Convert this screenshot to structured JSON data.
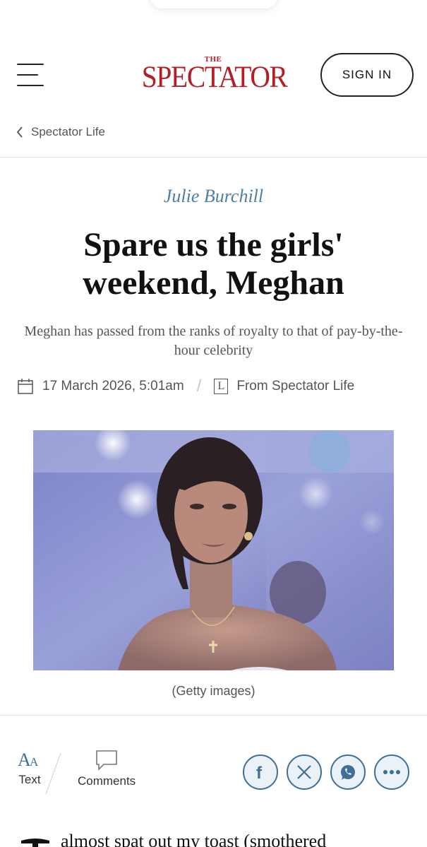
{
  "header": {
    "logo_the": "THE",
    "logo_main": "SPECTATOR",
    "signin_label": "SIGN IN"
  },
  "breadcrumb": {
    "label": "Spectator Life"
  },
  "article": {
    "author": "Julie Burchill",
    "headline": "Spare us the girls' weekend, Meghan",
    "standfirst": "Meghan has passed from the ranks of royalty to that of pay-by-the-hour celebrity",
    "date": "17 March 2026, 5:01am",
    "source": "From Spectator Life",
    "source_icon_letter": "L",
    "image_caption": "(Getty images)",
    "body_start": "almost spat out my toast (smothered"
  },
  "toolbar": {
    "text_label": "Text",
    "comments_label": "Comments",
    "share_buttons": [
      "facebook",
      "x",
      "whatsapp",
      "more"
    ]
  },
  "colors": {
    "brand_red": "#b51d24",
    "author_blue": "#4e7fa6",
    "share_blue": "#3f6f98"
  }
}
